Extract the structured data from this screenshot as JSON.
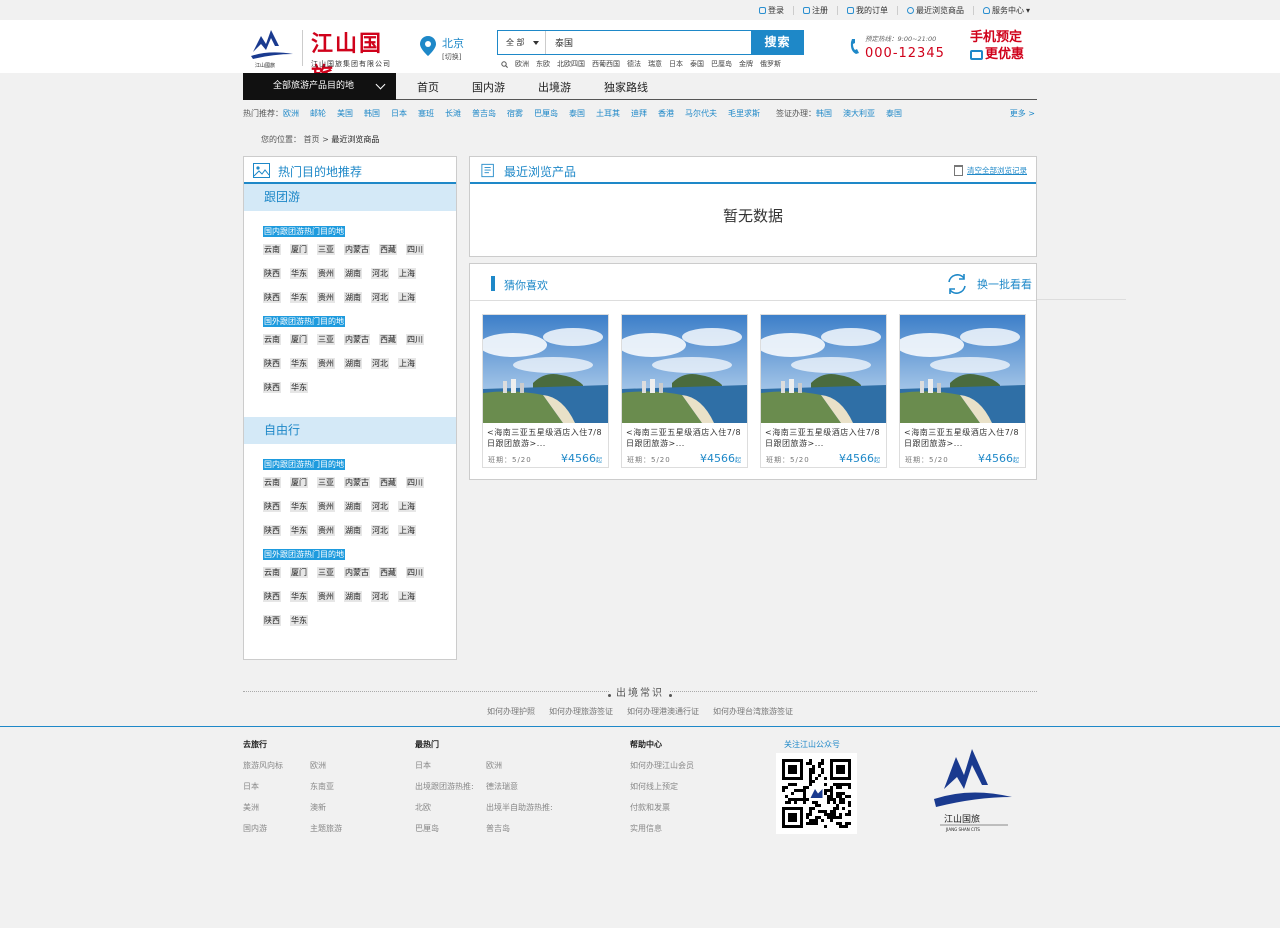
{
  "topbar": {
    "login": "登录",
    "register": "注册",
    "orders": "我的订单",
    "recent": "最近浏览商品",
    "service": "服务中心"
  },
  "header": {
    "brand": "江山国旅",
    "company": "江山国旅集团有限公司",
    "logo_text": "江山國旅",
    "city": "北京",
    "city_switch": "[切换]",
    "search_category": "全 部",
    "search_value": "泰国",
    "search_button": "搜索",
    "hot_words": [
      "欧洲",
      "东欧",
      "北欧四国",
      "西葡西国",
      "德法",
      "瑞意",
      "日本",
      "泰国",
      "巴厘岛",
      "金牌",
      "俄罗斯"
    ],
    "hotline_label": "预定热线：9:00~21:00",
    "hotline_number": "000-12345",
    "promo_line1": "手机预定",
    "promo_line2": "更优惠"
  },
  "nav": {
    "all_categories": "全部旅游产品目的地",
    "items": [
      "首页",
      "国内游",
      "出境游",
      "独家路线"
    ]
  },
  "hot_recommend": {
    "label": "热门推荐：",
    "links": [
      "欧洲",
      "邮轮",
      "美国",
      "韩国",
      "日本",
      "塞班",
      "长滩",
      "普吉岛",
      "宿雾",
      "巴厘岛",
      "泰国",
      "土耳其",
      "迪拜",
      "香港",
      "马尔代夫",
      "毛里求斯"
    ],
    "visa_label": "签证办理：",
    "visa_links": [
      "韩国",
      "澳大利亚",
      "泰国"
    ],
    "more": "更多 >"
  },
  "breadcrumb": {
    "label": "您的位置：",
    "home": "首页",
    "sep": ">",
    "current": "最近浏览商品"
  },
  "left_panel": {
    "title": "热门目的地推荐",
    "sections": [
      {
        "title": "跟团游",
        "groups": [
          {
            "title": "国内跟团游热门目的地",
            "rows": [
              [
                "云南",
                "厦门",
                "三亚",
                "内蒙古",
                "西藏",
                "四川"
              ],
              [
                "陕西",
                "华东",
                "贵州",
                "湖南",
                "河北",
                "上海"
              ],
              [
                "陕西",
                "华东",
                "贵州",
                "湖南",
                "河北",
                "上海"
              ]
            ]
          },
          {
            "title": "国外跟团游热门目的地",
            "rows": [
              [
                "云南",
                "厦门",
                "三亚",
                "内蒙古",
                "西藏",
                "四川"
              ],
              [
                "陕西",
                "华东",
                "贵州",
                "湖南",
                "河北",
                "上海"
              ],
              [
                "陕西",
                "华东"
              ]
            ]
          }
        ]
      },
      {
        "title": "自由行",
        "groups": [
          {
            "title": "国内跟团游热门目的地",
            "rows": [
              [
                "云南",
                "厦门",
                "三亚",
                "内蒙古",
                "西藏",
                "四川"
              ],
              [
                "陕西",
                "华东",
                "贵州",
                "湖南",
                "河北",
                "上海"
              ],
              [
                "陕西",
                "华东",
                "贵州",
                "湖南",
                "河北",
                "上海"
              ]
            ]
          },
          {
            "title": "国外跟团游热门目的地",
            "rows": [
              [
                "云南",
                "厦门",
                "三亚",
                "内蒙古",
                "西藏",
                "四川"
              ],
              [
                "陕西",
                "华东",
                "贵州",
                "湖南",
                "河北",
                "上海"
              ],
              [
                "陕西",
                "华东"
              ]
            ]
          }
        ]
      }
    ]
  },
  "recent_panel": {
    "title": "最近浏览产品",
    "clear": "清空全部浏览记录",
    "empty": "暂无数据"
  },
  "guess_panel": {
    "title": "猜你喜欢",
    "refresh": "换一批看看",
    "cards": [
      {
        "title": "<海南三亚五星级酒店入住7/8日跟团旅游>...",
        "date": "班期：5/20",
        "price": "¥4566",
        "unit": "起"
      },
      {
        "title": "<海南三亚五星级酒店入住7/8日跟团旅游>...",
        "date": "班期：5/20",
        "price": "¥4566",
        "unit": "起"
      },
      {
        "title": "<海南三亚五星级酒店入住7/8日跟团旅游>...",
        "date": "班期：5/20",
        "price": "¥4566",
        "unit": "起"
      },
      {
        "title": "<海南三亚五星级酒店入住7/8日跟团旅游>...",
        "date": "班期：5/20",
        "price": "¥4566",
        "unit": "起"
      }
    ]
  },
  "tips": {
    "title": "出境常识",
    "links": [
      "如何办理护照",
      "如何办理旅游签证",
      "如何办理港澳通行证",
      "如何办理台湾旅游签证"
    ]
  },
  "footer": {
    "col1": {
      "title": "去旅行",
      "links": [
        "旅游风向标",
        "欧洲",
        "日本",
        "东南亚",
        "美洲",
        "澳新",
        "国内游",
        "主题旅游"
      ]
    },
    "col2": {
      "title": "最热门",
      "links": [
        "日本",
        "欧洲",
        "出境跟团游热推:",
        "德法瑞意",
        "北欧",
        "出境半自助游热推:",
        "巴厘岛",
        "普吉岛"
      ]
    },
    "col3": {
      "title": "帮助中心",
      "links": [
        "如何办理江山会员",
        "如何线上预定",
        "付款和发票",
        "实用信息"
      ]
    },
    "qr_title": "关注江山公众号",
    "logo_text": "江山国旅",
    "logo_en": "JIANG SHAN CITS"
  },
  "colors": {
    "accent": "#1e88c8",
    "brand_red": "#d0021b"
  }
}
